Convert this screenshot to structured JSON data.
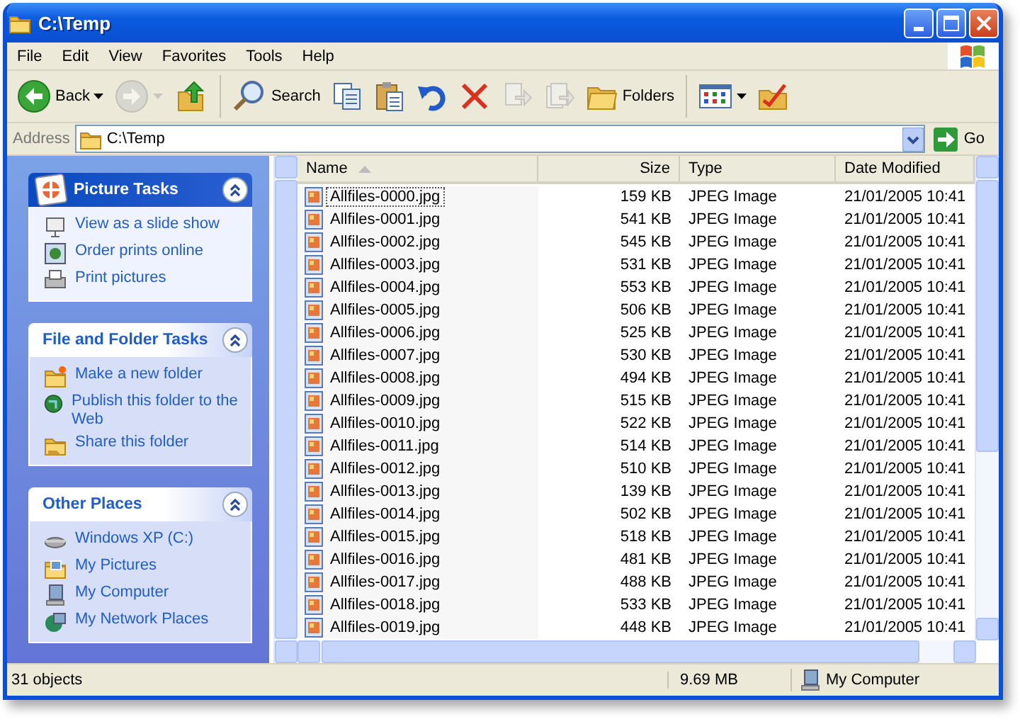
{
  "window": {
    "title": "C:\\Temp"
  },
  "menu": [
    "File",
    "Edit",
    "View",
    "Favorites",
    "Tools",
    "Help"
  ],
  "toolbar": [
    {
      "kind": "back",
      "label": "Back",
      "dropdown": true,
      "disabled": false
    },
    {
      "kind": "forward",
      "dropdown": true,
      "disabled": true
    },
    {
      "kind": "up",
      "disabled": false
    },
    {
      "kind": "separator"
    },
    {
      "kind": "search",
      "label": "Search",
      "disabled": false
    },
    {
      "kind": "copy",
      "disabled": false
    },
    {
      "kind": "paste",
      "disabled": false
    },
    {
      "kind": "undo",
      "disabled": false
    },
    {
      "kind": "delete",
      "disabled": false
    },
    {
      "kind": "moveto",
      "disabled": true
    },
    {
      "kind": "copyto",
      "disabled": true
    },
    {
      "kind": "folders",
      "label": "Folders",
      "disabled": false
    },
    {
      "kind": "separator"
    },
    {
      "kind": "views",
      "dropdown": true,
      "disabled": false
    },
    {
      "kind": "customize",
      "disabled": false
    }
  ],
  "address": {
    "label": "Address",
    "value": "C:\\Temp",
    "go": "Go"
  },
  "tasks": [
    {
      "title": "Picture Tasks",
      "kind": "special",
      "expanded": true,
      "items": [
        {
          "label": "View as a slide show",
          "kind": "slideshow"
        },
        {
          "label": "Order prints online",
          "kind": "prints"
        },
        {
          "label": "Print pictures",
          "kind": "print"
        }
      ]
    },
    {
      "title": "File and Folder Tasks",
      "kind": "normal",
      "expanded": true,
      "items": [
        {
          "label": "Make a new folder",
          "kind": "newfolder"
        },
        {
          "label": "Publish this folder to the Web",
          "kind": "publish"
        },
        {
          "label": "Share this folder",
          "kind": "share"
        }
      ]
    },
    {
      "title": "Other Places",
      "kind": "normal",
      "expanded": true,
      "items": [
        {
          "label": "Windows XP (C:)",
          "kind": "drive"
        },
        {
          "label": "My Pictures",
          "kind": "pictures"
        },
        {
          "label": "My Computer",
          "kind": "computer"
        },
        {
          "label": "My Network Places",
          "kind": "network"
        }
      ]
    }
  ],
  "columns": [
    {
      "label": "Name",
      "sorted": true
    },
    {
      "label": "Size",
      "sorted": false
    },
    {
      "label": "Type",
      "sorted": false
    },
    {
      "label": "Date Modified",
      "sorted": false
    }
  ],
  "rows": [
    {
      "name": "Allfiles-0000.jpg",
      "size": "159 KB",
      "type": "JPEG Image",
      "date": "21/01/2005 10:41",
      "focused": true
    },
    {
      "name": "Allfiles-0001.jpg",
      "size": "541 KB",
      "type": "JPEG Image",
      "date": "21/01/2005 10:41",
      "focused": false
    },
    {
      "name": "Allfiles-0002.jpg",
      "size": "545 KB",
      "type": "JPEG Image",
      "date": "21/01/2005 10:41",
      "focused": false
    },
    {
      "name": "Allfiles-0003.jpg",
      "size": "531 KB",
      "type": "JPEG Image",
      "date": "21/01/2005 10:41",
      "focused": false
    },
    {
      "name": "Allfiles-0004.jpg",
      "size": "553 KB",
      "type": "JPEG Image",
      "date": "21/01/2005 10:41",
      "focused": false
    },
    {
      "name": "Allfiles-0005.jpg",
      "size": "506 KB",
      "type": "JPEG Image",
      "date": "21/01/2005 10:41",
      "focused": false
    },
    {
      "name": "Allfiles-0006.jpg",
      "size": "525 KB",
      "type": "JPEG Image",
      "date": "21/01/2005 10:41",
      "focused": false
    },
    {
      "name": "Allfiles-0007.jpg",
      "size": "530 KB",
      "type": "JPEG Image",
      "date": "21/01/2005 10:41",
      "focused": false
    },
    {
      "name": "Allfiles-0008.jpg",
      "size": "494 KB",
      "type": "JPEG Image",
      "date": "21/01/2005 10:41",
      "focused": false
    },
    {
      "name": "Allfiles-0009.jpg",
      "size": "515 KB",
      "type": "JPEG Image",
      "date": "21/01/2005 10:41",
      "focused": false
    },
    {
      "name": "Allfiles-0010.jpg",
      "size": "522 KB",
      "type": "JPEG Image",
      "date": "21/01/2005 10:41",
      "focused": false
    },
    {
      "name": "Allfiles-0011.jpg",
      "size": "514 KB",
      "type": "JPEG Image",
      "date": "21/01/2005 10:41",
      "focused": false
    },
    {
      "name": "Allfiles-0012.jpg",
      "size": "510 KB",
      "type": "JPEG Image",
      "date": "21/01/2005 10:41",
      "focused": false
    },
    {
      "name": "Allfiles-0013.jpg",
      "size": "139 KB",
      "type": "JPEG Image",
      "date": "21/01/2005 10:41",
      "focused": false
    },
    {
      "name": "Allfiles-0014.jpg",
      "size": "502 KB",
      "type": "JPEG Image",
      "date": "21/01/2005 10:41",
      "focused": false
    },
    {
      "name": "Allfiles-0015.jpg",
      "size": "518 KB",
      "type": "JPEG Image",
      "date": "21/01/2005 10:41",
      "focused": false
    },
    {
      "name": "Allfiles-0016.jpg",
      "size": "481 KB",
      "type": "JPEG Image",
      "date": "21/01/2005 10:41",
      "focused": false
    },
    {
      "name": "Allfiles-0017.jpg",
      "size": "488 KB",
      "type": "JPEG Image",
      "date": "21/01/2005 10:41",
      "focused": false
    },
    {
      "name": "Allfiles-0018.jpg",
      "size": "533 KB",
      "type": "JPEG Image",
      "date": "21/01/2005 10:41",
      "focused": false
    },
    {
      "name": "Allfiles-0019.jpg",
      "size": "448 KB",
      "type": "JPEG Image",
      "date": "21/01/2005 10:41",
      "focused": false
    }
  ],
  "status_bar": {
    "objects": "31 objects",
    "size": "9.69 MB",
    "zone": "My Computer"
  }
}
